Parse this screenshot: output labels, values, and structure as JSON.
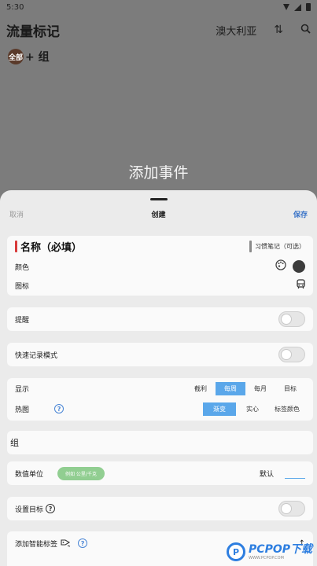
{
  "status": {
    "time": "5:30"
  },
  "app": {
    "title": "流量标记",
    "region": "澳大利亚",
    "group_all": "全部",
    "group_add": "+ 组"
  },
  "sheet": {
    "heading": "添加事件",
    "cancel": "取消",
    "create": "创建",
    "save": "保存",
    "name_label": "名称（必填）",
    "habit_label": "习惯笔记（可选）",
    "color_label": "颜色",
    "icon_label": "图标",
    "reminder_label": "提醒",
    "reminder_on": false,
    "quick_record_label": "快速记录模式",
    "quick_record_on": false,
    "display_label": "显示",
    "display_options": [
      "截利",
      "每周",
      "每月",
      "目标"
    ],
    "display_selected": "每周",
    "heatmap_label": "热图",
    "heatmap_options": [
      "渐变",
      "实心",
      "标签颜色"
    ],
    "heatmap_selected": "渐变",
    "group_label": "组",
    "unit_label": "数值单位",
    "unit_placeholder": "例如 公里/千克",
    "default_label": "默认",
    "goal_label": "设置目标",
    "goal_on": false,
    "smart_tag_label": "添加智能标签"
  },
  "colors": {
    "accent": "#5aa7ea",
    "save": "#3a74c8",
    "name_bar": "#d83a3a",
    "unit_pill": "#7fc77f"
  },
  "watermark": {
    "main": "PCPOP下载",
    "sub": "WWW.PCPOP.COM"
  }
}
